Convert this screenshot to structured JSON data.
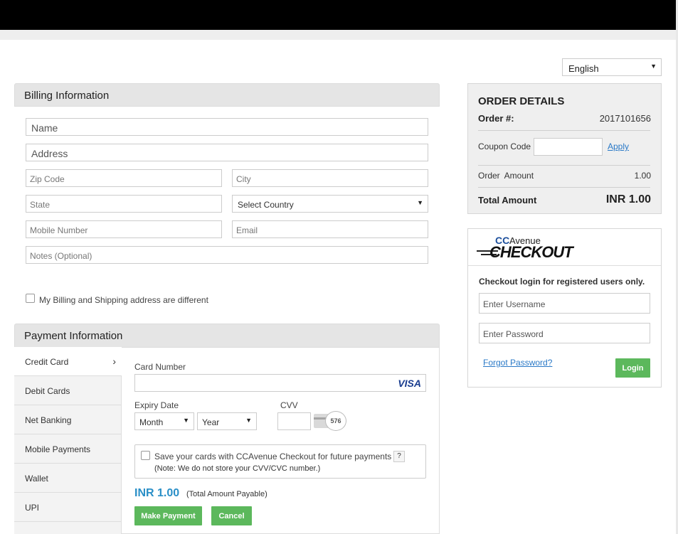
{
  "language": {
    "selected": "English"
  },
  "billing": {
    "title": "Billing Information",
    "name_placeholder": "Name",
    "address_placeholder": "Address",
    "zip_placeholder": "Zip Code",
    "city_placeholder": "City",
    "state_placeholder": "State",
    "country_selected": "Select Country",
    "mobile_placeholder": "Mobile Number",
    "email_placeholder": "Email",
    "notes_placeholder": "Notes (Optional)",
    "different_address_label": "My Billing and Shipping address are different"
  },
  "payment": {
    "title": "Payment Information",
    "tabs": [
      {
        "label": "Credit Card"
      },
      {
        "label": "Debit Cards"
      },
      {
        "label": "Net Banking"
      },
      {
        "label": "Mobile Payments"
      },
      {
        "label": "Wallet"
      },
      {
        "label": "UPI"
      }
    ],
    "card_number_label": "Card Number",
    "card_brand": "VISA",
    "expiry_label": "Expiry Date",
    "month_selected": "Month",
    "year_selected": "Year",
    "cvv_label": "CVV",
    "cvv_sample": "576",
    "save_cards_label": "Save your cards with CCAvenue Checkout for future payments",
    "save_cards_help": "?",
    "save_cards_note": "(Note: We do not store your CVV/CVC number.)",
    "amount": "INR 1.00",
    "amount_note": "(Total Amount Payable)",
    "make_payment_label": "Make Payment",
    "cancel_label": "Cancel"
  },
  "order": {
    "title": "ORDER DETAILS",
    "order_no_label": "Order #:",
    "order_no": "2017101656",
    "coupon_label": "Coupon Code",
    "apply_label": "Apply",
    "amount_label": "Order  Amount",
    "amount_value": "1.00",
    "total_label": "Total Amount",
    "total_value": "INR 1.00"
  },
  "checkout": {
    "logo_cc": "CC",
    "logo_avenue": "Avenue",
    "logo_checkout": "CHECKOUT",
    "login_note": "Checkout login for registered users only.",
    "username_placeholder": "Enter Username",
    "password_placeholder": "Enter Password",
    "forgot_label": "Forgot Password?",
    "login_label": "Login"
  },
  "colors": {
    "accent_green": "#5cb85c",
    "accent_blue": "#2a79c7",
    "amount_blue": "#2a8fc7"
  }
}
